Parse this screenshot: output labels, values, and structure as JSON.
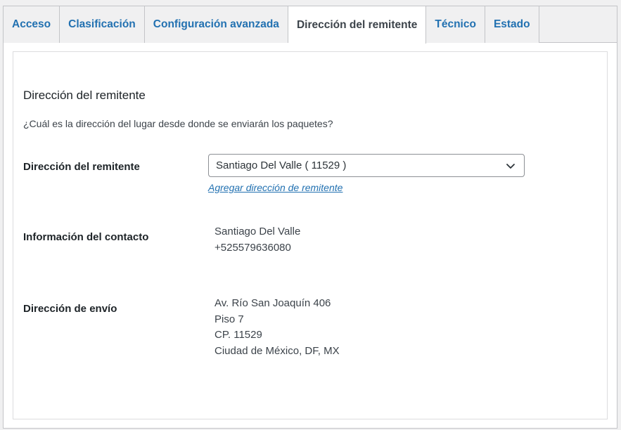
{
  "tabs": [
    {
      "label": "Acceso",
      "active": false
    },
    {
      "label": "Clasificación",
      "active": false
    },
    {
      "label": "Configuración avanzada",
      "active": false
    },
    {
      "label": "Dirección del remitente",
      "active": true
    },
    {
      "label": "Técnico",
      "active": false
    },
    {
      "label": "Estado",
      "active": false
    }
  ],
  "section": {
    "title": "Dirección del remitente",
    "description": "¿Cuál es la dirección del lugar desde donde se enviarán los paquetes?"
  },
  "fields": {
    "sender_address": {
      "label": "Dirección del remitente",
      "selected": "Santiago Del Valle ( 11529 )",
      "add_link": "Agregar dirección de remitente"
    },
    "contact_info": {
      "label": "Información del contacto",
      "name": "Santiago Del Valle",
      "phone": "+525579636080"
    },
    "shipping_address": {
      "label": "Dirección de envío",
      "line1": "Av. Río San Joaquín 406",
      "line2": "Piso 7",
      "line3": "CP. 11529",
      "line4": "Ciudad de México, DF, MX"
    }
  },
  "colors": {
    "accent": "#2271b1",
    "border": "#c3c4c7",
    "background": "#f0f0f1"
  },
  "icons": {
    "select_arrow": "chevron-down-icon"
  }
}
